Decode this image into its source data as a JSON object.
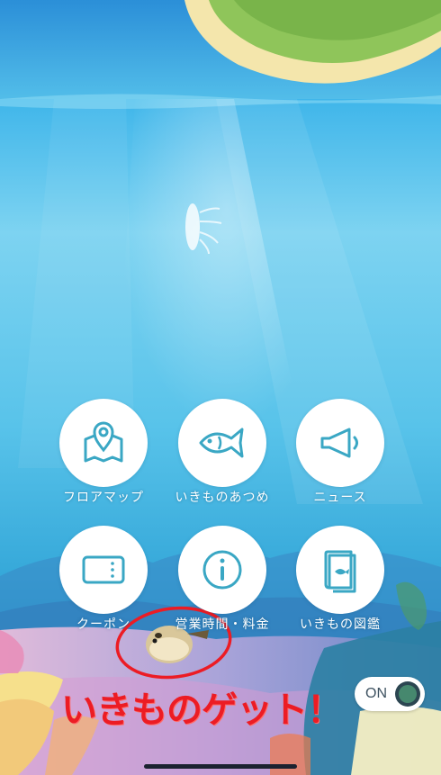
{
  "menu": [
    {
      "label": "フロアマップ",
      "icon": "map-pin-icon"
    },
    {
      "label": "いきものあつめ",
      "icon": "fish-icon"
    },
    {
      "label": "ニュース",
      "icon": "megaphone-icon"
    },
    {
      "label": "クーポン",
      "icon": "ticket-icon"
    },
    {
      "label": "営業時間・料金",
      "icon": "info-icon"
    },
    {
      "label": "いきもの図鑑",
      "icon": "book-icon"
    }
  ],
  "toggle": {
    "label": "ON"
  },
  "annotation": {
    "text": "いきものゲット！",
    "color": "#ec1c24"
  },
  "colors": {
    "icon": "#3aa7c4",
    "sea_top": "#2e9ce0",
    "annotation": "#ec1c24"
  }
}
